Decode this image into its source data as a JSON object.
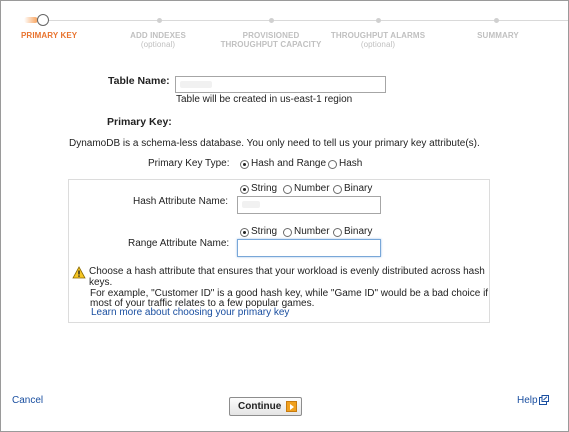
{
  "wizard": {
    "steps": [
      {
        "label": "PRIMARY KEY",
        "sub": ""
      },
      {
        "label": "ADD INDEXES",
        "sub": "(optional)"
      },
      {
        "label": "PROVISIONED",
        "sub": "THROUGHPUT CAPACITY"
      },
      {
        "label": "THROUGHPUT ALARMS",
        "sub": "(optional)"
      },
      {
        "label": "SUMMARY",
        "sub": ""
      }
    ],
    "accent": "#e8732e"
  },
  "table": {
    "name_label": "Table Name:",
    "name_value": "",
    "region_note": "Table will be created in us-east-1 region"
  },
  "primary_key": {
    "heading": "Primary Key:",
    "description": "DynamoDB is a schema-less database. You only need to tell us your primary key attribute(s).",
    "type_label": "Primary Key Type:",
    "type_options": [
      "Hash and Range",
      "Hash"
    ],
    "type_selected": "Hash and Range",
    "hash": {
      "type_options": [
        "String",
        "Number",
        "Binary"
      ],
      "type_selected": "String",
      "label": "Hash Attribute Name:",
      "value": ""
    },
    "range": {
      "type_options": [
        "String",
        "Number",
        "Binary"
      ],
      "type_selected": "String",
      "label": "Range Attribute Name:",
      "value": ""
    }
  },
  "warning": {
    "icon": "warning-icon",
    "line1": "Choose a hash attribute that ensures that your workload is evenly distributed across hash",
    "line2": "keys.",
    "line3": "For example, \"Customer ID\" is a good hash key, while \"Game ID\" would be a bad choice if",
    "line4": "most of your traffic relates to a few popular games.",
    "link": "Learn more about choosing your primary key"
  },
  "footer": {
    "cancel": "Cancel",
    "continue": "Continue",
    "help": "Help"
  }
}
